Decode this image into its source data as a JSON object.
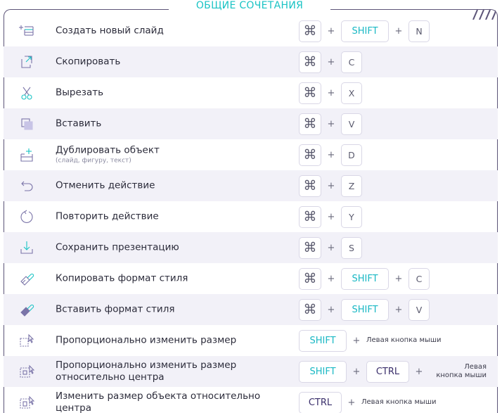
{
  "title": "ОБЩИЕ СОЧЕТАНИЯ",
  "colors": {
    "accent_teal": "#19c3c4",
    "border_purple": "#5c5478",
    "row_shade": "#f2f1f8",
    "ctrl_text": "#3a2f6b"
  },
  "rows": [
    {
      "icon": "new-slide-icon",
      "label": "Создать новый слайд",
      "keys": [
        "cmd",
        "+",
        "SHIFT",
        "+",
        "N"
      ]
    },
    {
      "icon": "copy-icon",
      "label": "Скопировать",
      "keys": [
        "cmd",
        "+",
        "C"
      ]
    },
    {
      "icon": "scissors-icon",
      "label": "Вырезать",
      "keys": [
        "cmd",
        "+",
        "X"
      ]
    },
    {
      "icon": "paste-icon",
      "label": "Вставить",
      "keys": [
        "cmd",
        "+",
        "V"
      ]
    },
    {
      "icon": "duplicate-icon",
      "label": "Дублировать объект",
      "sublabel": "(слайд, фигуру, текст)",
      "keys": [
        "cmd",
        "+",
        "D"
      ]
    },
    {
      "icon": "undo-icon",
      "label": "Отменить действие",
      "keys": [
        "cmd",
        "+",
        "Z"
      ]
    },
    {
      "icon": "redo-icon",
      "label": "Повторить действие",
      "keys": [
        "cmd",
        "+",
        "Y"
      ]
    },
    {
      "icon": "download-icon",
      "label": "Сохранить презентацию",
      "keys": [
        "cmd",
        "+",
        "S"
      ]
    },
    {
      "icon": "format-brush-icon",
      "label": "Копировать формат стиля",
      "keys": [
        "cmd",
        "+",
        "SHIFT",
        "+",
        "C"
      ]
    },
    {
      "icon": "format-brush-filled-icon",
      "label": "Вставить формат стиля",
      "keys": [
        "cmd",
        "+",
        "SHIFT",
        "+",
        "V"
      ]
    },
    {
      "icon": "resize-icon",
      "label": "Пропорционально изменить размер",
      "keys": [
        "SHIFT",
        "+"
      ],
      "mouse": "Левая кнопка мыши"
    },
    {
      "icon": "resize-center-icon",
      "label": "Пропорционально изменить размер относительно центра",
      "keys": [
        "SHIFT",
        "+",
        "CTRL",
        "+"
      ],
      "mouse": "Левая кнопка мыши"
    },
    {
      "icon": "resize-object-icon",
      "label": "Изменить размер объекта относительно центра",
      "keys": [
        "CTRL",
        "+"
      ],
      "mouse": "Левая кнопка мыши"
    }
  ],
  "labels": {
    "shift": "SHIFT",
    "ctrl": "CTRL",
    "plus": "+",
    "mouse_one": "Левая кнопка мыши",
    "mouse_two_line1": "Левая",
    "mouse_two_line2": "кнопка мыши"
  }
}
